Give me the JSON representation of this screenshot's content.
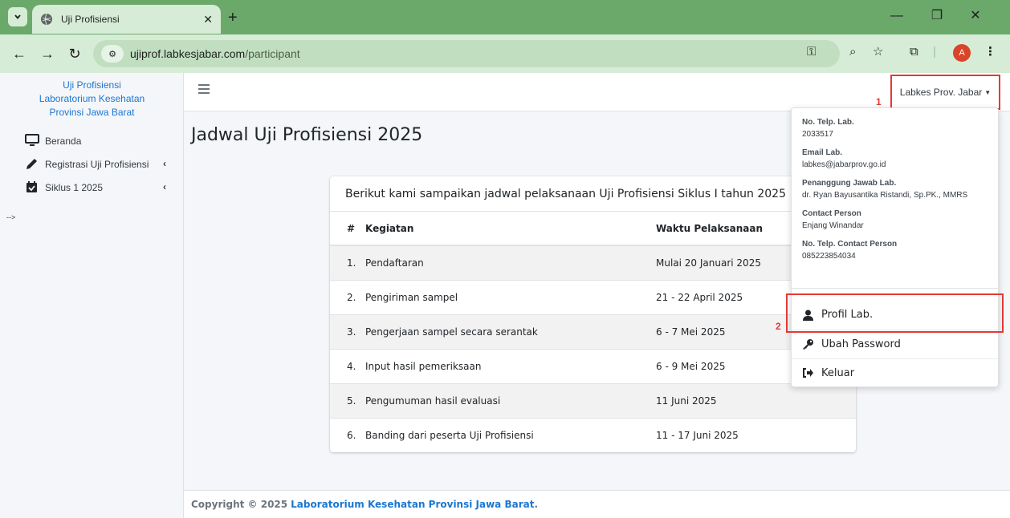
{
  "browser": {
    "tab_title": "Uji Profisiensi",
    "url_host": "ujiprof.labkesjabar.com",
    "url_path": "/participant",
    "profile_initial": "A"
  },
  "sidebar": {
    "brand": [
      "Uji Profisiensi",
      "Laboratorium Kesehatan",
      "Provinsi Jawa Barat"
    ],
    "items": [
      {
        "label": "Beranda",
        "icon": "monitor-icon"
      },
      {
        "label": "Registrasi Uji Profisiensi",
        "icon": "pencil-icon"
      },
      {
        "label": "Siklus 1 2025",
        "icon": "calendar-check-icon"
      }
    ],
    "stray_text": "-->"
  },
  "topnav": {
    "user_menu": "Labkes Prov. Jabar",
    "annotation_1": "1",
    "annotation_2": "2"
  },
  "page": {
    "title": "Jadwal Uji Profisiensi 2025",
    "card_header": "Berikut kami sampaikan jadwal pelaksanaan Uji Profisiensi Siklus I tahun 2025",
    "table": {
      "headers": [
        "#",
        "Kegiatan",
        "Waktu Pelaksanaan"
      ],
      "rows": [
        [
          "1.",
          "Pendaftaran",
          "Mulai 20 Januari 2025"
        ],
        [
          "2.",
          "Pengiriman sampel",
          "21 - 22 April 2025"
        ],
        [
          "3.",
          "Pengerjaan sampel secara serantak",
          "6 - 7 Mei 2025"
        ],
        [
          "4.",
          "Input hasil pemeriksaan",
          "6 - 9 Mei 2025"
        ],
        [
          "5.",
          "Pengumuman hasil evaluasi",
          "11 Juni 2025"
        ],
        [
          "6.",
          "Banding dari peserta Uji Profisiensi",
          "11 - 17 Juni 2025"
        ]
      ]
    }
  },
  "dropdown": {
    "info": [
      {
        "label": "No. Telp. Lab.",
        "value": "2033517"
      },
      {
        "label": "Email Lab.",
        "value": "labkes@jabarprov.go.id"
      },
      {
        "label": "Penanggung Jawab Lab.",
        "value": "dr. Ryan Bayusantika Ristandi, Sp.PK., MMRS"
      },
      {
        "label": "Contact Person",
        "value": "Enjang Winandar"
      },
      {
        "label": "No. Telp. Contact Person",
        "value": "085223854034"
      }
    ],
    "actions": [
      {
        "label": "Profil Lab.",
        "icon": "user-icon"
      },
      {
        "label": "Ubah Password",
        "icon": "key-icon"
      },
      {
        "label": "Keluar",
        "icon": "sign-out-icon"
      }
    ]
  },
  "footer": {
    "prefix": "Copyright © 2025",
    "link": "Laboratorium Kesehatan Provinsi Jawa Barat",
    "suffix": "."
  },
  "colors": {
    "chrome_green": "#6ba96b",
    "chrome_light": "#d7ecd6",
    "link_blue": "#1b77d2",
    "annotation_red": "#e53935"
  }
}
